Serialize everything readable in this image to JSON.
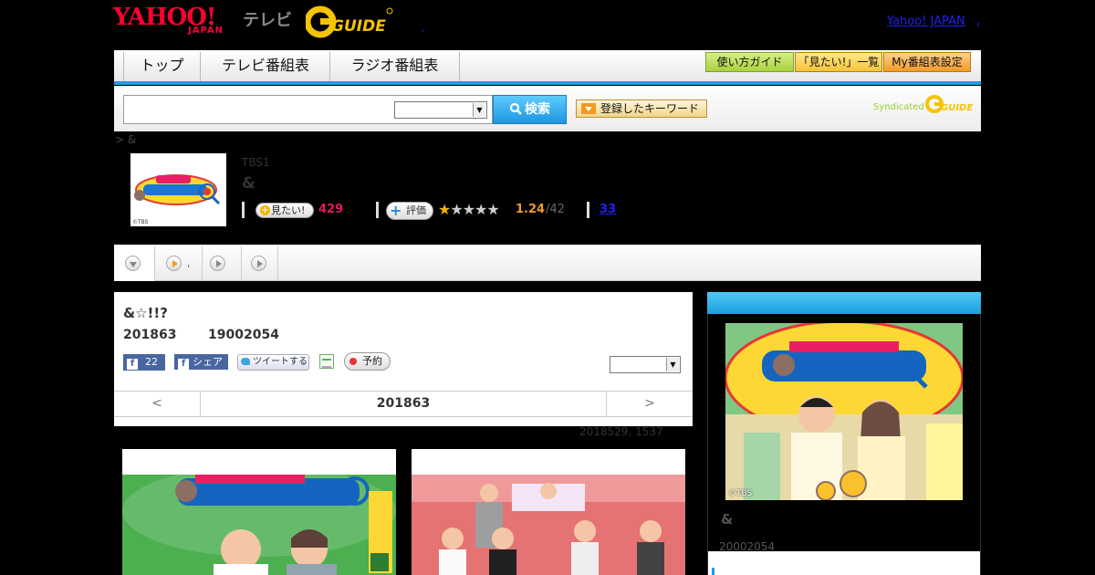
{
  "header": {
    "brand_yahoo": "YAHOO!",
    "brand_japan": "JAPAN",
    "brand_tv": "テレビ",
    "gguide_logo": "GUIDE",
    "yahoo_japan_link": "Yahoo! JAPAN",
    "link_separator": ",",
    "dot": ","
  },
  "nav": {
    "tabs": [
      {
        "label": "トップ"
      },
      {
        "label": "テレビ番組表"
      },
      {
        "label": "ラジオ番組表"
      }
    ],
    "buttons": [
      {
        "label": "使い方ガイド"
      },
      {
        "label": "「見たい!」一覧"
      },
      {
        "label": "My番組表設定"
      }
    ],
    "accent_color": "#1aa0e0"
  },
  "search": {
    "input_value": "",
    "select_value": "",
    "search_button": "検索",
    "keyword_button": "登録したキーワード",
    "syndicated_label": "Syndicated",
    "syndicated_logo": "GUIDE"
  },
  "breadcrumb": "> &",
  "program": {
    "thumb_copyright": "©TBS",
    "station": "TBS1",
    "title": "&",
    "want_label": "見たい!",
    "want_count": "429",
    "rate_label": "評価",
    "rating_stars": 1,
    "rating_max": 5,
    "rating_value": "1.24",
    "rating_count": "/42",
    "link_count": "33"
  },
  "tabs_row": {
    "dot_text": ","
  },
  "article": {
    "title": "&☆!!?",
    "date": "201863",
    "program_id": "19002054",
    "fb_like_count": "22",
    "fb_share": "シェア",
    "tweet": "ツイートする",
    "reserve": "予約",
    "select_value": "",
    "pager_prev": "<",
    "pager_current": "201863",
    "pager_next": ">",
    "updated": "2018529, 1537"
  },
  "right_panel": {
    "photo_copyright": "©TBS",
    "title": "&",
    "program_id": "20002054"
  }
}
